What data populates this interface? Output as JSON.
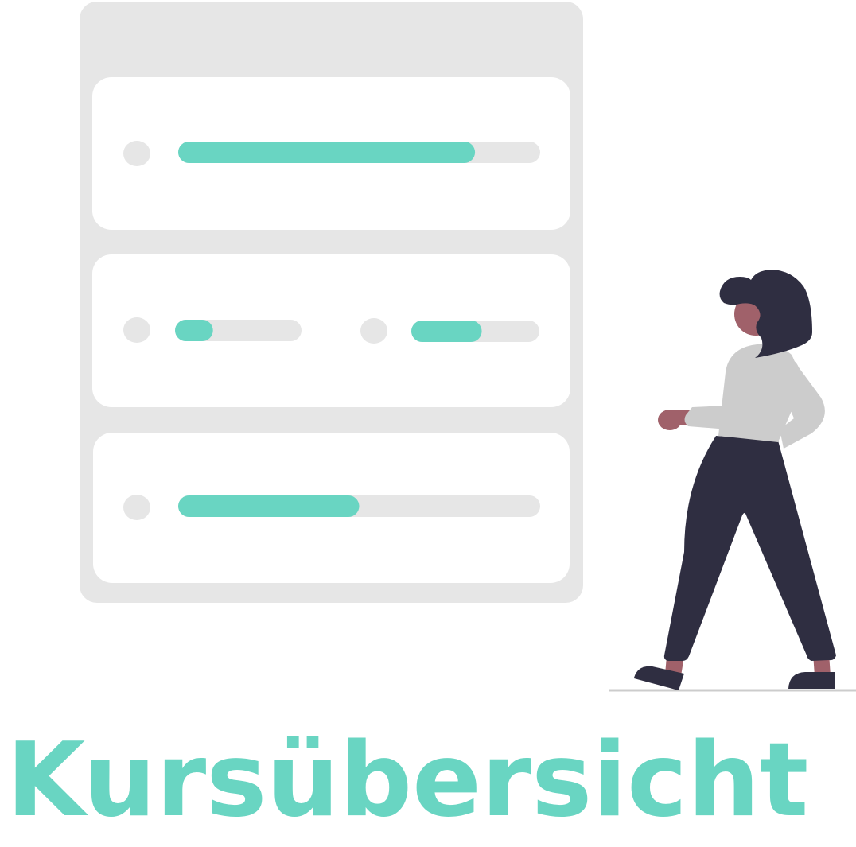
{
  "title": "Kursübersicht",
  "colors": {
    "accent": "#69d5c2",
    "panel": "#e6e6e6",
    "card": "#ffffff",
    "track": "#e6e6e6",
    "hair_pants": "#2f2e41",
    "skin": "#a0616a",
    "shirt": "#cccccc"
  },
  "progress": {
    "card1": [
      0.82
    ],
    "card2": [
      0.3,
      0.55
    ],
    "card3": [
      0.5
    ]
  }
}
